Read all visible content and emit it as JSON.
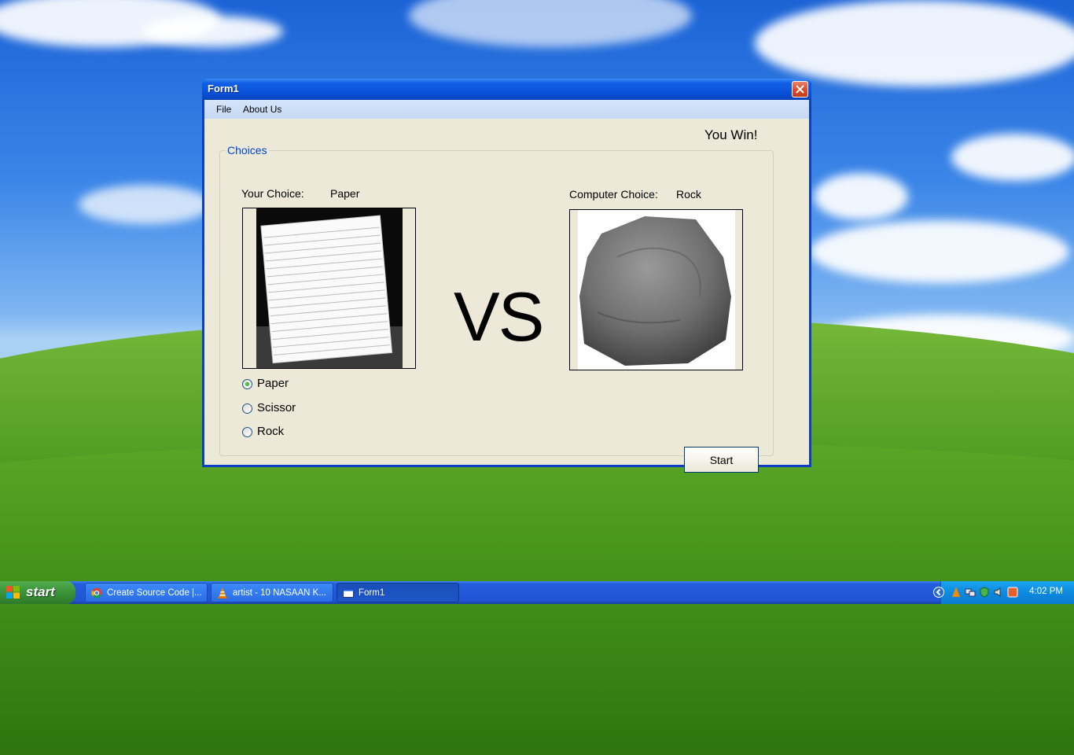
{
  "window": {
    "title": "Form1",
    "menu": [
      "File",
      "About Us"
    ]
  },
  "form": {
    "result_text": "You Win!",
    "group_title": "Choices",
    "your_choice_label": "Your Choice:",
    "your_choice_value": "Paper",
    "computer_choice_label": "Computer Choice:",
    "computer_choice_value": "Rock",
    "vs_text": "VS",
    "options": [
      {
        "label": "Paper",
        "checked": true
      },
      {
        "label": "Scissor",
        "checked": false
      },
      {
        "label": "Rock",
        "checked": false
      }
    ],
    "start_button": "Start"
  },
  "taskbar": {
    "start_label": "start",
    "tasks": [
      {
        "label": "Create Source Code |...",
        "icon": "chrome-icon"
      },
      {
        "label": "artist - 10 NASAAN K...",
        "icon": "vlc-icon"
      },
      {
        "label": "Form1",
        "icon": "window-icon",
        "active": true
      }
    ],
    "clock": "4:02 PM"
  }
}
